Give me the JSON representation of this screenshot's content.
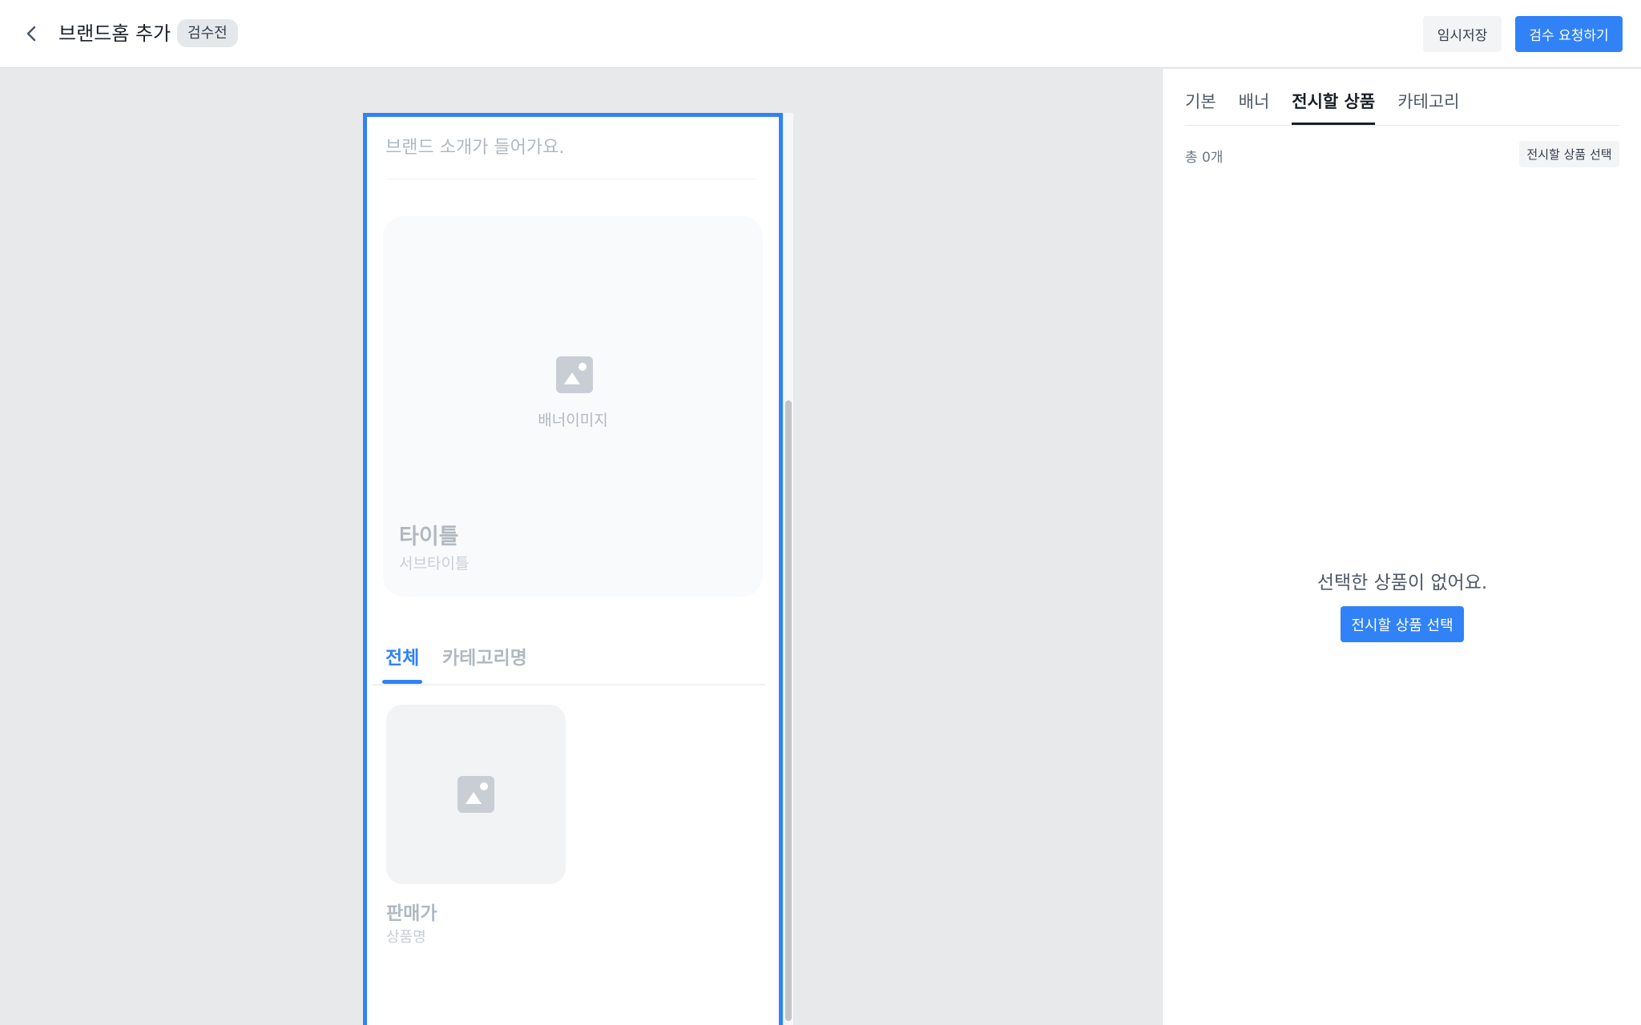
{
  "header": {
    "back_icon": "chevron-left-icon",
    "title": "브랜드홈 추가",
    "status_badge": "검수전",
    "save_label": "임시저장",
    "request_label": "검수 요청하기"
  },
  "preview": {
    "brand_intro_placeholder": "브랜드 소개가 들어가요.",
    "banner": {
      "image_icon": "image-icon",
      "image_label": "배너이미지",
      "title": "타이틀",
      "subtitle": "서브타이틀"
    },
    "tabs": [
      {
        "label": "전체",
        "active": true
      },
      {
        "label": "카테고리명",
        "active": false
      }
    ],
    "product": {
      "image_icon": "image-icon",
      "price": "판매가",
      "name": "상품명"
    }
  },
  "panel": {
    "tabs": [
      {
        "label": "기본",
        "active": false
      },
      {
        "label": "배너",
        "active": false
      },
      {
        "label": "전시할 상품",
        "active": true
      },
      {
        "label": "카테고리",
        "active": false
      }
    ],
    "total_count": "총 0개",
    "select_small_label": "전시할 상품 선택",
    "empty_message": "선택한 상품이 없어요.",
    "select_main_label": "전시할 상품 선택"
  },
  "colors": {
    "accent": "#3182f6",
    "background": "#e8e9eb",
    "placeholder_text": "#b0b8c1"
  }
}
